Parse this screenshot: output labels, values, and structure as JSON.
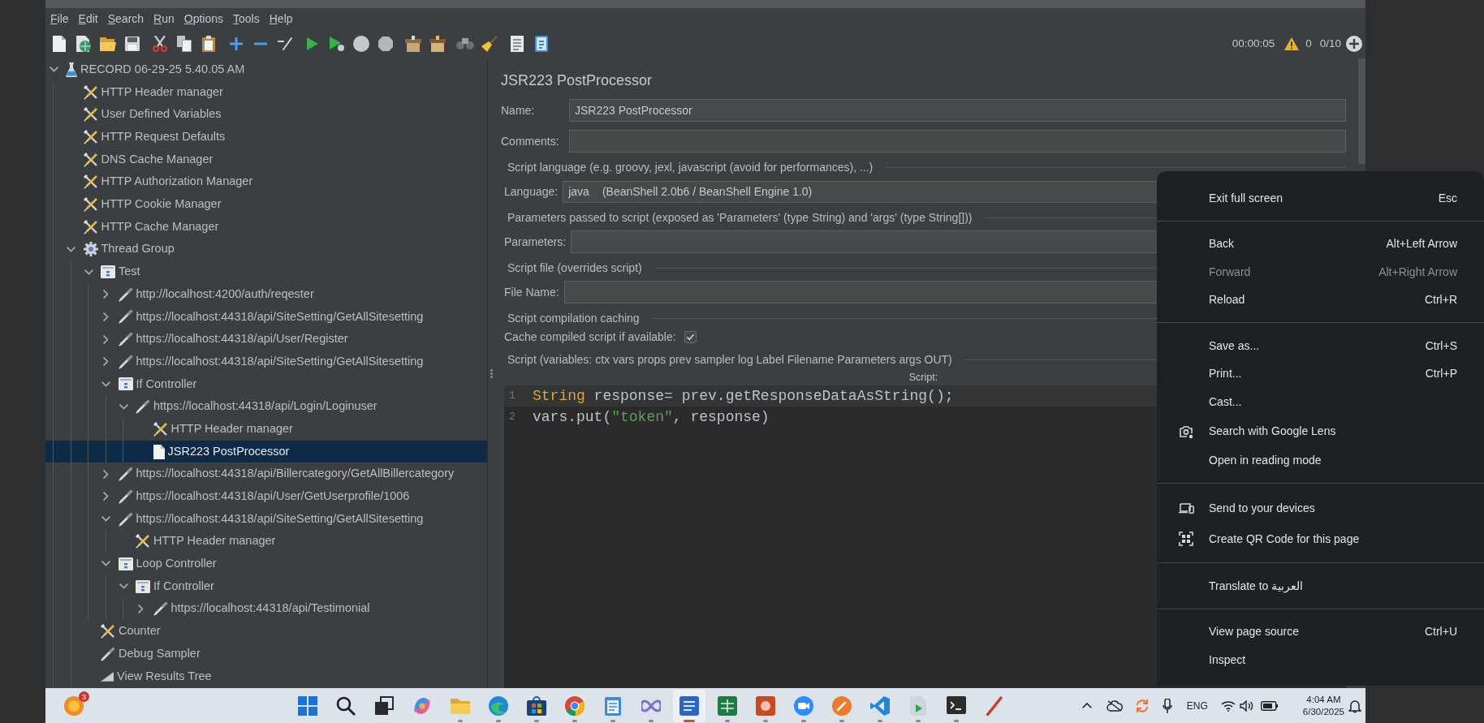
{
  "menu_bar": {
    "items": [
      "File",
      "Edit",
      "Search",
      "Run",
      "Options",
      "Tools",
      "Help"
    ]
  },
  "toolbar": {
    "elapsed_time": "00:00:05",
    "warning_count": "0",
    "active_threads": "0/10"
  },
  "tree": {
    "nodes": [
      {
        "label": "RECORD 06-29-25 5.40.05 AM",
        "kind": "plan",
        "expanded": true,
        "selected": false,
        "children": [
          {
            "label": "HTTP Header manager",
            "kind": "config",
            "selected": false
          },
          {
            "label": "User Defined Variables",
            "kind": "config",
            "selected": false
          },
          {
            "label": "HTTP Request Defaults",
            "kind": "config",
            "selected": false
          },
          {
            "label": "DNS Cache Manager",
            "kind": "config",
            "selected": false
          },
          {
            "label": "HTTP Authorization Manager",
            "kind": "config",
            "selected": false
          },
          {
            "label": "HTTP Cookie Manager",
            "kind": "config",
            "selected": false
          },
          {
            "label": "HTTP Cache Manager",
            "kind": "config",
            "selected": false
          },
          {
            "label": "Thread Group",
            "kind": "threads",
            "expanded": true,
            "selected": false,
            "children": [
              {
                "label": "Test",
                "kind": "controller",
                "expanded": true,
                "selected": false,
                "children": [
                  {
                    "label": "http://localhost:4200/auth/reqester",
                    "kind": "sampler",
                    "expanded": false,
                    "selected": false
                  },
                  {
                    "label": "https://localhost:44318/api/SiteSetting/GetAllSitesetting",
                    "kind": "sampler",
                    "expanded": false,
                    "selected": false
                  },
                  {
                    "label": "https://localhost:44318/api/User/Register",
                    "kind": "sampler",
                    "expanded": false,
                    "selected": false
                  },
                  {
                    "label": "https://localhost:44318/api/SiteSetting/GetAllSitesetting",
                    "kind": "sampler",
                    "expanded": false,
                    "selected": false
                  },
                  {
                    "label": "If Controller",
                    "kind": "controller",
                    "expanded": true,
                    "selected": false,
                    "children": [
                      {
                        "label": "https://localhost:44318/api/Login/Loginuser",
                        "kind": "sampler",
                        "expanded": true,
                        "selected": false,
                        "children": [
                          {
                            "label": "HTTP Header manager",
                            "kind": "config",
                            "selected": false
                          },
                          {
                            "label": "JSR223 PostProcessor",
                            "kind": "processor",
                            "selected": true
                          }
                        ]
                      }
                    ]
                  },
                  {
                    "label": "https://localhost:44318/api/Billercategory/GetAllBillercategory",
                    "kind": "sampler",
                    "expanded": false,
                    "selected": false
                  },
                  {
                    "label": "https://localhost:44318/api/User/GetUserprofile/1006",
                    "kind": "sampler",
                    "expanded": false,
                    "selected": false
                  },
                  {
                    "label": "https://localhost:44318/api/SiteSetting/GetAllSitesetting",
                    "kind": "sampler",
                    "expanded": true,
                    "selected": false,
                    "children": [
                      {
                        "label": "HTTP Header manager",
                        "kind": "config",
                        "selected": false
                      }
                    ]
                  },
                  {
                    "label": "Loop Controller",
                    "kind": "controller",
                    "expanded": true,
                    "selected": false,
                    "children": [
                      {
                        "label": "If Controller",
                        "kind": "controller",
                        "expanded": true,
                        "selected": false,
                        "children": [
                          {
                            "label": "https://localhost:44318/api/Testimonial",
                            "kind": "sampler",
                            "expanded": false,
                            "selected": false
                          }
                        ]
                      }
                    ]
                  }
                ]
              },
              {
                "label": "Counter",
                "kind": "config",
                "selected": false
              },
              {
                "label": "Debug Sampler",
                "kind": "sampler",
                "selected": false
              },
              {
                "label": "View Results Tree",
                "kind": "listener",
                "selected": false
              }
            ]
          }
        ]
      }
    ]
  },
  "element_panel": {
    "title": "JSR223 PostProcessor",
    "rows": [
      {
        "kind": "field",
        "label": "Name:",
        "value": "JSR223 PostProcessor"
      },
      {
        "kind": "field",
        "label": "Comments:"
      },
      {
        "kind": "heading",
        "text": "Script language (e.g. groovy, jexl, javascript (avoid for performances), ...)"
      },
      {
        "kind": "select",
        "label": "Language:",
        "value": "java",
        "detail": "(BeanShell 2.0b6 / BeanShell Engine 1.0)"
      },
      {
        "kind": "heading",
        "text": "Parameters passed to script (exposed as 'Parameters' (type String) and 'args' (type String[]))"
      },
      {
        "kind": "field",
        "label": "Parameters:"
      },
      {
        "kind": "heading",
        "text": "Script file (overrides script)"
      },
      {
        "kind": "field",
        "label": "File Name:"
      },
      {
        "kind": "heading",
        "text": "Script compilation caching"
      },
      {
        "kind": "checkbox",
        "label": "Cache compiled script if available:",
        "checked": true
      },
      {
        "kind": "heading",
        "text": "Script (variables: ctx vars props prev sampler log Label Filename Parameters args OUT)"
      }
    ]
  },
  "script_editor": {
    "caption": "Script:",
    "lines": [
      {
        "number": "1",
        "current": true,
        "tokens": [
          {
            "text": "String",
            "kind": "type"
          },
          {
            "text": " response= prev.getResponseDataAsString();",
            "kind": "plain"
          }
        ]
      },
      {
        "number": "2",
        "current": false,
        "tokens": [
          {
            "text": "vars.put(",
            "kind": "plain"
          },
          {
            "text": "\"token\"",
            "kind": "string"
          },
          {
            "text": ", response)",
            "kind": "plain"
          }
        ]
      }
    ]
  },
  "context_menu": {
    "groups": [
      {
        "items": [
          {
            "label": "Exit full screen",
            "shortcut": "Esc",
            "disabled": false,
            "kind": "plain"
          }
        ]
      },
      {
        "items": [
          {
            "label": "Back",
            "shortcut": "Alt+Left Arrow",
            "disabled": false,
            "kind": "plain"
          },
          {
            "label": "Forward",
            "shortcut": "Alt+Right Arrow",
            "disabled": true,
            "kind": "plain"
          },
          {
            "label": "Reload",
            "shortcut": "Ctrl+R",
            "disabled": false,
            "kind": "plain"
          }
        ]
      },
      {
        "items": [
          {
            "label": "Save as...",
            "shortcut": "Ctrl+S",
            "disabled": false,
            "kind": "plain"
          },
          {
            "label": "Print...",
            "shortcut": "Ctrl+P",
            "disabled": false,
            "kind": "plain"
          },
          {
            "label": "Cast...",
            "disabled": false,
            "kind": "plain"
          },
          {
            "label": "Search with Google Lens",
            "disabled": false,
            "kind": "lens"
          },
          {
            "label": "Open in reading mode",
            "disabled": false,
            "kind": "plain"
          }
        ]
      },
      {
        "items": [
          {
            "label": "Send to your devices",
            "disabled": false,
            "kind": "devices"
          },
          {
            "label": "Create QR Code for this page",
            "disabled": false,
            "kind": "qrcode"
          }
        ]
      },
      {
        "items": [
          {
            "label": "Translate to العربية",
            "disabled": false,
            "kind": "plain"
          }
        ]
      },
      {
        "items": [
          {
            "label": "View page source",
            "shortcut": "Ctrl+U",
            "disabled": false,
            "kind": "plain"
          },
          {
            "label": "Inspect",
            "disabled": false,
            "kind": "plain"
          }
        ]
      }
    ]
  },
  "taskbar": {
    "widget_badge": "3",
    "apps": [
      {
        "kind": "tiles",
        "running": false,
        "selected": false
      },
      {
        "kind": "magnifier",
        "running": false,
        "selected": false
      },
      {
        "kind": "stacked",
        "running": false,
        "selected": false
      },
      {
        "kind": "swirl",
        "running": false,
        "selected": false
      },
      {
        "kind": "folder",
        "running": true,
        "selected": false
      },
      {
        "kind": "wave",
        "running": true,
        "selected": false
      },
      {
        "kind": "bag",
        "running": true,
        "selected": false
      },
      {
        "kind": "aperture",
        "running": true,
        "selected": false
      },
      {
        "kind": "notepad",
        "running": true,
        "selected": false
      },
      {
        "kind": "infinity",
        "running": true,
        "selected": false
      },
      {
        "kind": "doctile",
        "running": true,
        "selected": true
      },
      {
        "kind": "sheettile",
        "running": true,
        "selected": false
      },
      {
        "kind": "slidetile",
        "running": true,
        "selected": false
      },
      {
        "kind": "camera",
        "running": true,
        "selected": false
      },
      {
        "kind": "pencircle",
        "running": true,
        "selected": false
      },
      {
        "kind": "ribbon",
        "running": true,
        "selected": false
      },
      {
        "kind": "playdoc",
        "running": true,
        "selected": false
      },
      {
        "kind": "terminal",
        "running": true,
        "selected": false
      },
      {
        "kind": "pen",
        "running": false,
        "selected": false
      }
    ],
    "language": "ENG",
    "time": "4:04 AM",
    "date": "6/30/2025"
  }
}
